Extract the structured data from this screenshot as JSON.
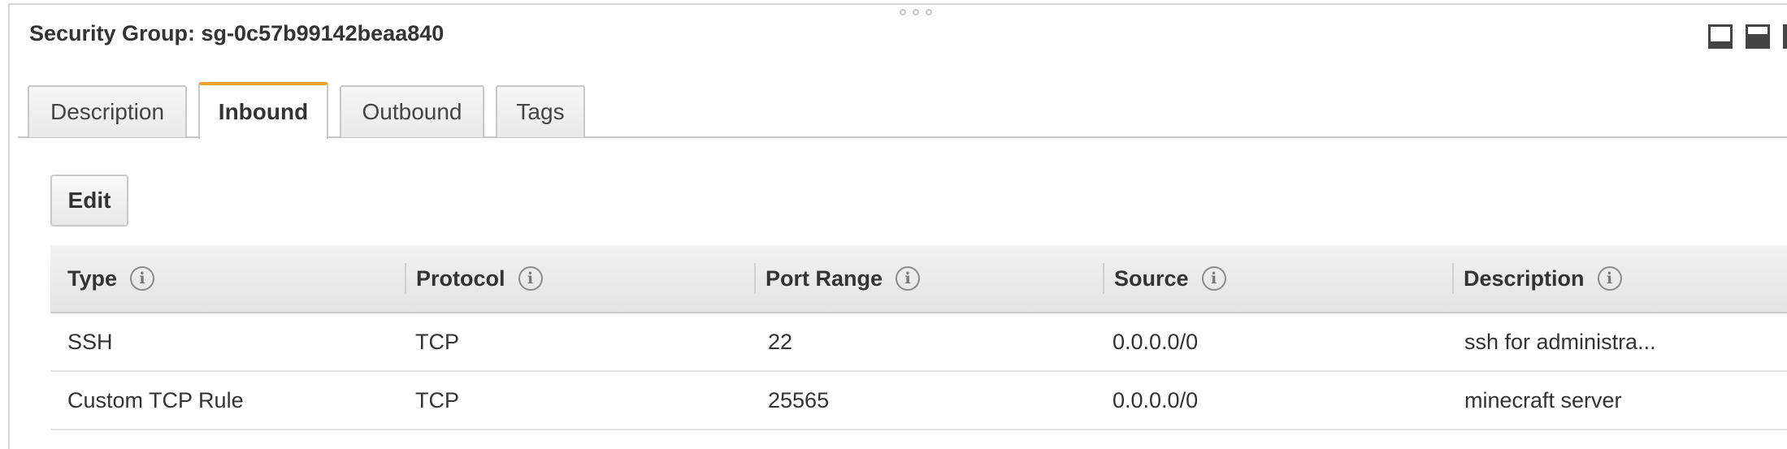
{
  "panel": {
    "title": "Security Group: sg-0c57b99142beaa840"
  },
  "tabs": [
    {
      "label": "Description",
      "active": false
    },
    {
      "label": "Inbound",
      "active": true
    },
    {
      "label": "Outbound",
      "active": false
    },
    {
      "label": "Tags",
      "active": false
    }
  ],
  "toolbar": {
    "edit_label": "Edit"
  },
  "table": {
    "columns": [
      "Type",
      "Protocol",
      "Port Range",
      "Source",
      "Description"
    ],
    "info_glyph": "i",
    "rows": [
      {
        "type": "SSH",
        "protocol": "TCP",
        "port_range": "22",
        "source": "0.0.0.0/0",
        "description": "ssh for administra..."
      },
      {
        "type": "Custom TCP Rule",
        "protocol": "TCP",
        "port_range": "25565",
        "source": "0.0.0.0/0",
        "description": "minecraft server"
      }
    ]
  },
  "icons": {
    "layout_bottom": "panel-bottom-icon",
    "layout_split": "panel-split-icon",
    "layout_side": "panel-side-icon",
    "drag": "drag-handle-icon",
    "info": "info-icon"
  },
  "colors": {
    "active_tab_accent": "#f0a22e",
    "text": "#333333",
    "border": "#c8c8c8"
  }
}
